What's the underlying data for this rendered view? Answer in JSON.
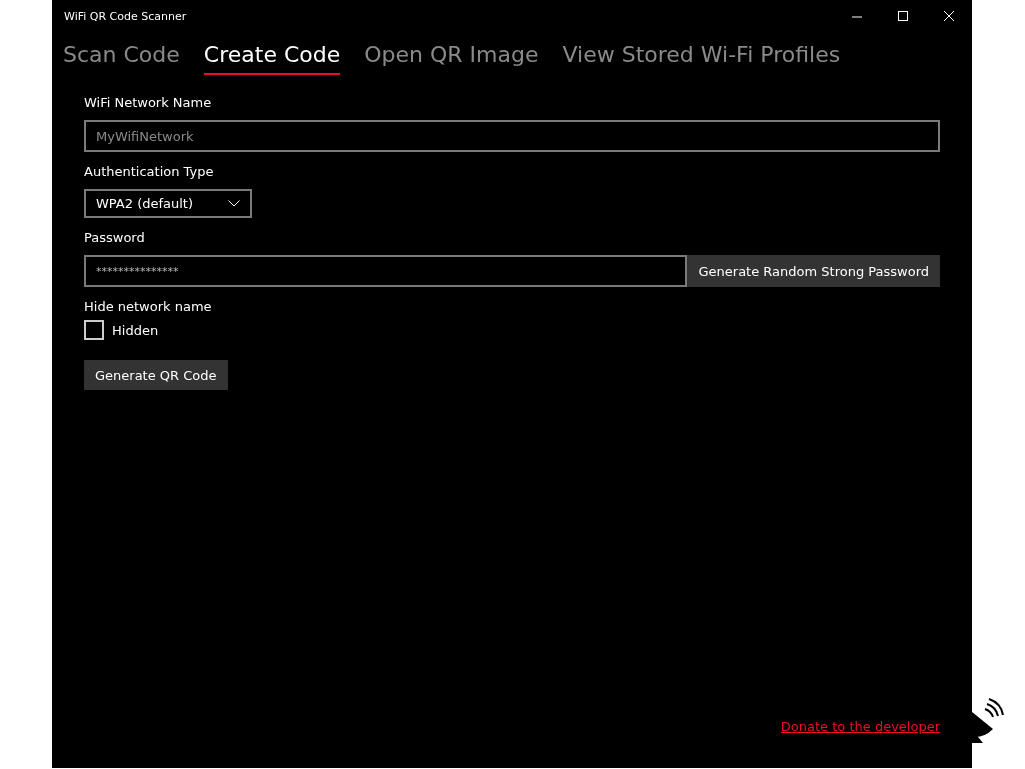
{
  "window": {
    "title": "WiFi QR Code Scanner"
  },
  "tabs": [
    {
      "label": "Scan Code",
      "selected": false
    },
    {
      "label": "Create Code",
      "selected": true
    },
    {
      "label": "Open QR Image",
      "selected": false
    },
    {
      "label": "View Stored Wi-Fi Profiles",
      "selected": false
    }
  ],
  "network_name": {
    "label": "WiFi Network Name",
    "placeholder": "MyWifiNetwork"
  },
  "authentication": {
    "label": "Authentication Type",
    "value": "WPA2 (default)"
  },
  "password": {
    "label": "Password",
    "value": "***************",
    "button": "Generate Random Strong Password"
  },
  "hide_network": {
    "label": "Hide network name",
    "checkbox_label": "Hidden",
    "checked": false
  },
  "generate_button": "Generate QR Code",
  "donate_link": "Donate to the developer"
}
